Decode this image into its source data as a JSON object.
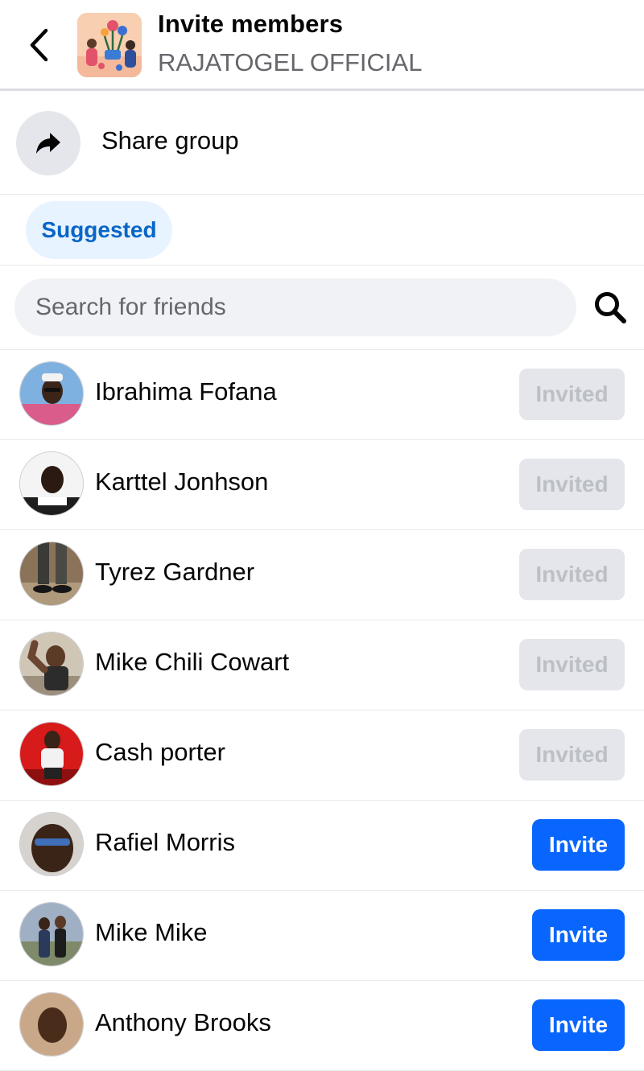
{
  "header": {
    "title": "Invite members",
    "subtitle": "RAJATOGEL OFFICIAL",
    "back_icon": "chevron-left-icon"
  },
  "share": {
    "label": "Share group",
    "icon": "share-arrow-icon"
  },
  "filters": {
    "chips": [
      {
        "label": "Suggested",
        "selected": true
      }
    ]
  },
  "search": {
    "placeholder": "Search for friends",
    "value": "",
    "icon": "search-icon"
  },
  "friends": [
    {
      "name": "Ibrahima Fofana",
      "status": "invited",
      "button_label": "Invited"
    },
    {
      "name": "Karttel Jonhson",
      "status": "invited",
      "button_label": "Invited"
    },
    {
      "name": "Tyrez Gardner",
      "status": "invited",
      "button_label": "Invited"
    },
    {
      "name": "Mike Chili Cowart",
      "status": "invited",
      "button_label": "Invited"
    },
    {
      "name": "Cash porter",
      "status": "invited",
      "button_label": "Invited"
    },
    {
      "name": "Rafiel Morris",
      "status": "invite",
      "button_label": "Invite"
    },
    {
      "name": "Mike Mike",
      "status": "invite",
      "button_label": "Invite"
    },
    {
      "name": "Anthony Brooks",
      "status": "invite",
      "button_label": "Invite"
    }
  ],
  "colors": {
    "accent": "#0866ff",
    "chip_bg": "#e7f3ff",
    "chip_text": "#0866c6",
    "invited_bg": "#e4e6eb",
    "invited_text": "#bcc0c4",
    "secondary_text": "#65676b"
  }
}
